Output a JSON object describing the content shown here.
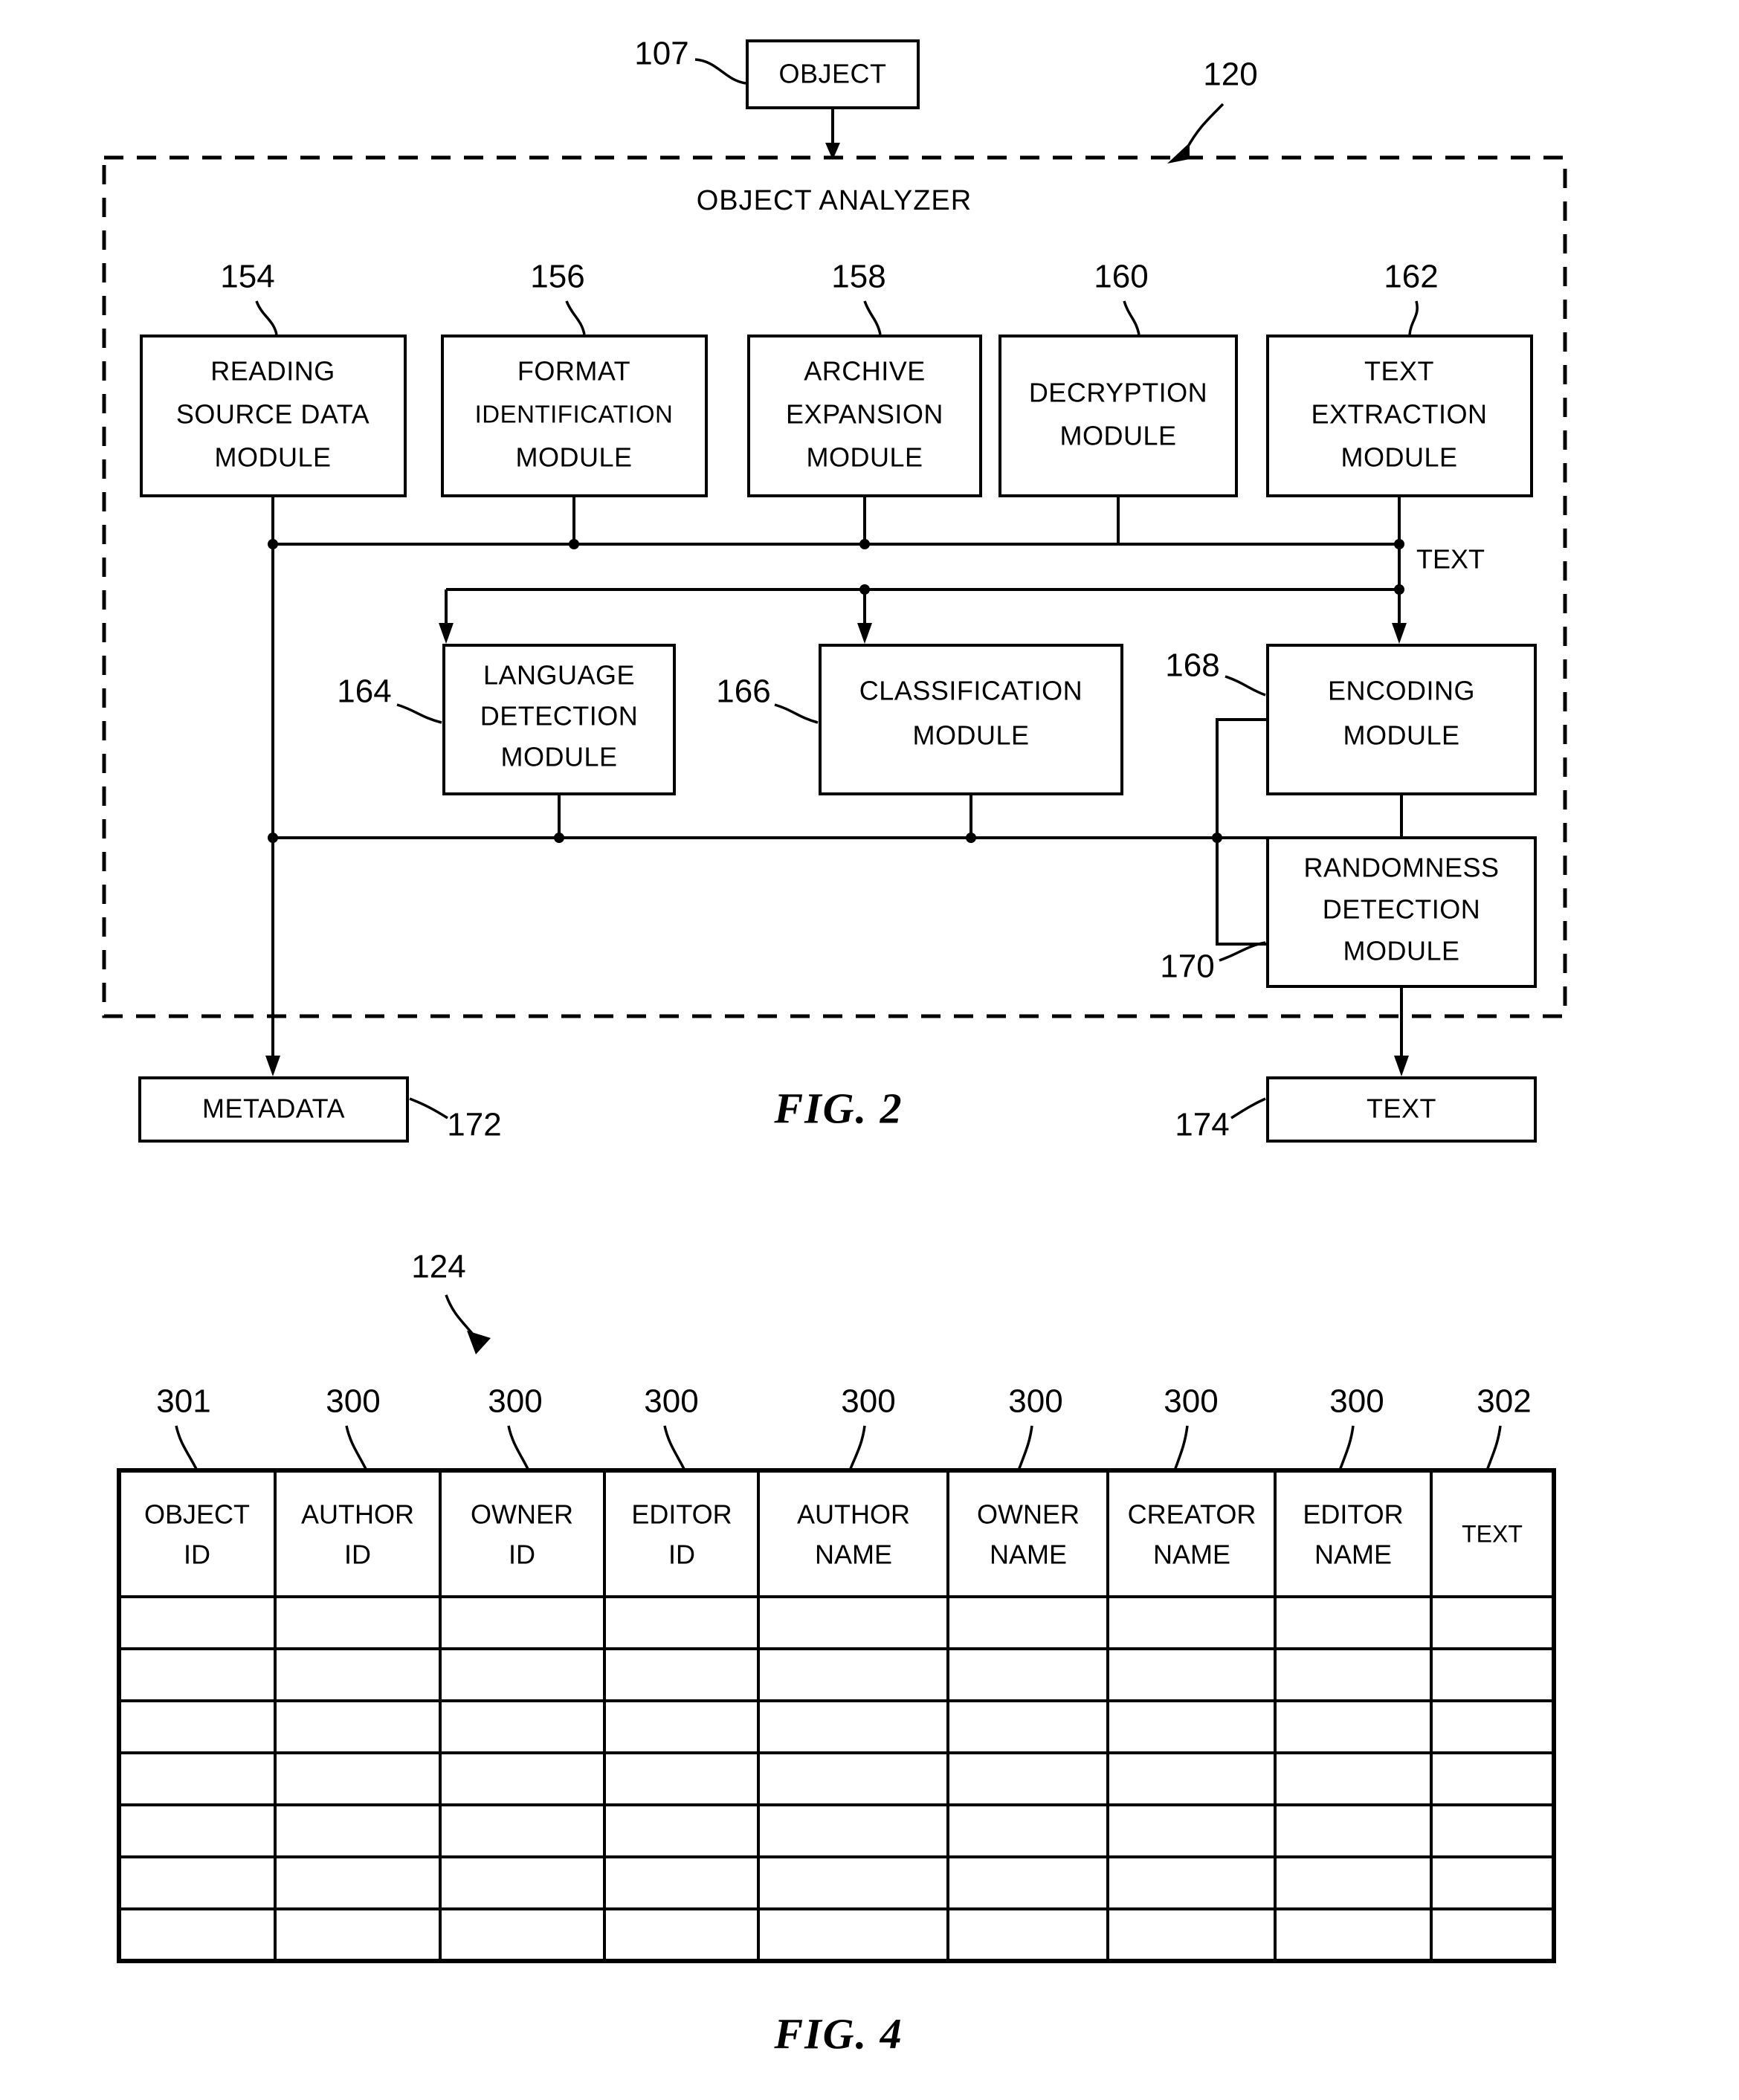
{
  "figures": [
    {
      "id": "fig2",
      "caption": "FIG. 2",
      "container": {
        "title": "OBJECT ANALYZER",
        "ref": "120"
      },
      "input": {
        "label": "OBJECT",
        "ref": "107"
      },
      "signal_labels": [
        {
          "text": "TEXT"
        }
      ],
      "top_modules": [
        {
          "ref": "154",
          "lines": [
            "READING",
            "SOURCE DATA",
            "MODULE"
          ]
        },
        {
          "ref": "156",
          "lines": [
            "FORMAT",
            "IDENTIFICATION",
            "MODULE"
          ]
        },
        {
          "ref": "158",
          "lines": [
            "ARCHIVE",
            "EXPANSION",
            "MODULE"
          ]
        },
        {
          "ref": "160",
          "lines": [
            "DECRYPTION",
            "MODULE"
          ]
        },
        {
          "ref": "162",
          "lines": [
            "TEXT",
            "EXTRACTION",
            "MODULE"
          ]
        }
      ],
      "mid_modules": [
        {
          "ref": "164",
          "lines": [
            "LANGUAGE",
            "DETECTION",
            "MODULE"
          ]
        },
        {
          "ref": "166",
          "lines": [
            "CLASSIFICATION",
            "MODULE"
          ]
        },
        {
          "ref": "168",
          "lines": [
            "ENCODING",
            "MODULE"
          ]
        },
        {
          "ref": "170",
          "lines": [
            "RANDOMNESS",
            "DETECTION",
            "MODULE"
          ]
        }
      ],
      "outputs": [
        {
          "ref": "172",
          "label": "METADATA"
        },
        {
          "ref": "174",
          "label": "TEXT"
        }
      ]
    },
    {
      "id": "fig4",
      "caption": "FIG. 4",
      "table_ref": "124",
      "column_refs": [
        "301",
        "300",
        "300",
        "300",
        "300",
        "300",
        "300",
        "300",
        "302"
      ],
      "columns": [
        {
          "lines": [
            "OBJECT",
            "ID"
          ]
        },
        {
          "lines": [
            "AUTHOR",
            "ID"
          ]
        },
        {
          "lines": [
            "OWNER",
            "ID"
          ]
        },
        {
          "lines": [
            "EDITOR",
            "ID"
          ]
        },
        {
          "lines": [
            "AUTHOR",
            "NAME"
          ]
        },
        {
          "lines": [
            "OWNER",
            "NAME"
          ]
        },
        {
          "lines": [
            "CREATOR",
            "NAME"
          ]
        },
        {
          "lines": [
            "EDITOR",
            "NAME"
          ]
        },
        {
          "lines": [
            "TEXT"
          ]
        }
      ],
      "body_row_count": 7,
      "body_rows": [
        [
          "",
          "",
          "",
          "",
          "",
          "",
          "",
          "",
          ""
        ],
        [
          "",
          "",
          "",
          "",
          "",
          "",
          "",
          "",
          ""
        ],
        [
          "",
          "",
          "",
          "",
          "",
          "",
          "",
          "",
          ""
        ],
        [
          "",
          "",
          "",
          "",
          "",
          "",
          "",
          "",
          ""
        ],
        [
          "",
          "",
          "",
          "",
          "",
          "",
          "",
          "",
          ""
        ],
        [
          "",
          "",
          "",
          "",
          "",
          "",
          "",
          "",
          ""
        ],
        [
          "",
          "",
          "",
          "",
          "",
          "",
          "",
          "",
          ""
        ]
      ]
    }
  ],
  "colors": {
    "ink": "#000000",
    "paper": "#ffffff"
  }
}
